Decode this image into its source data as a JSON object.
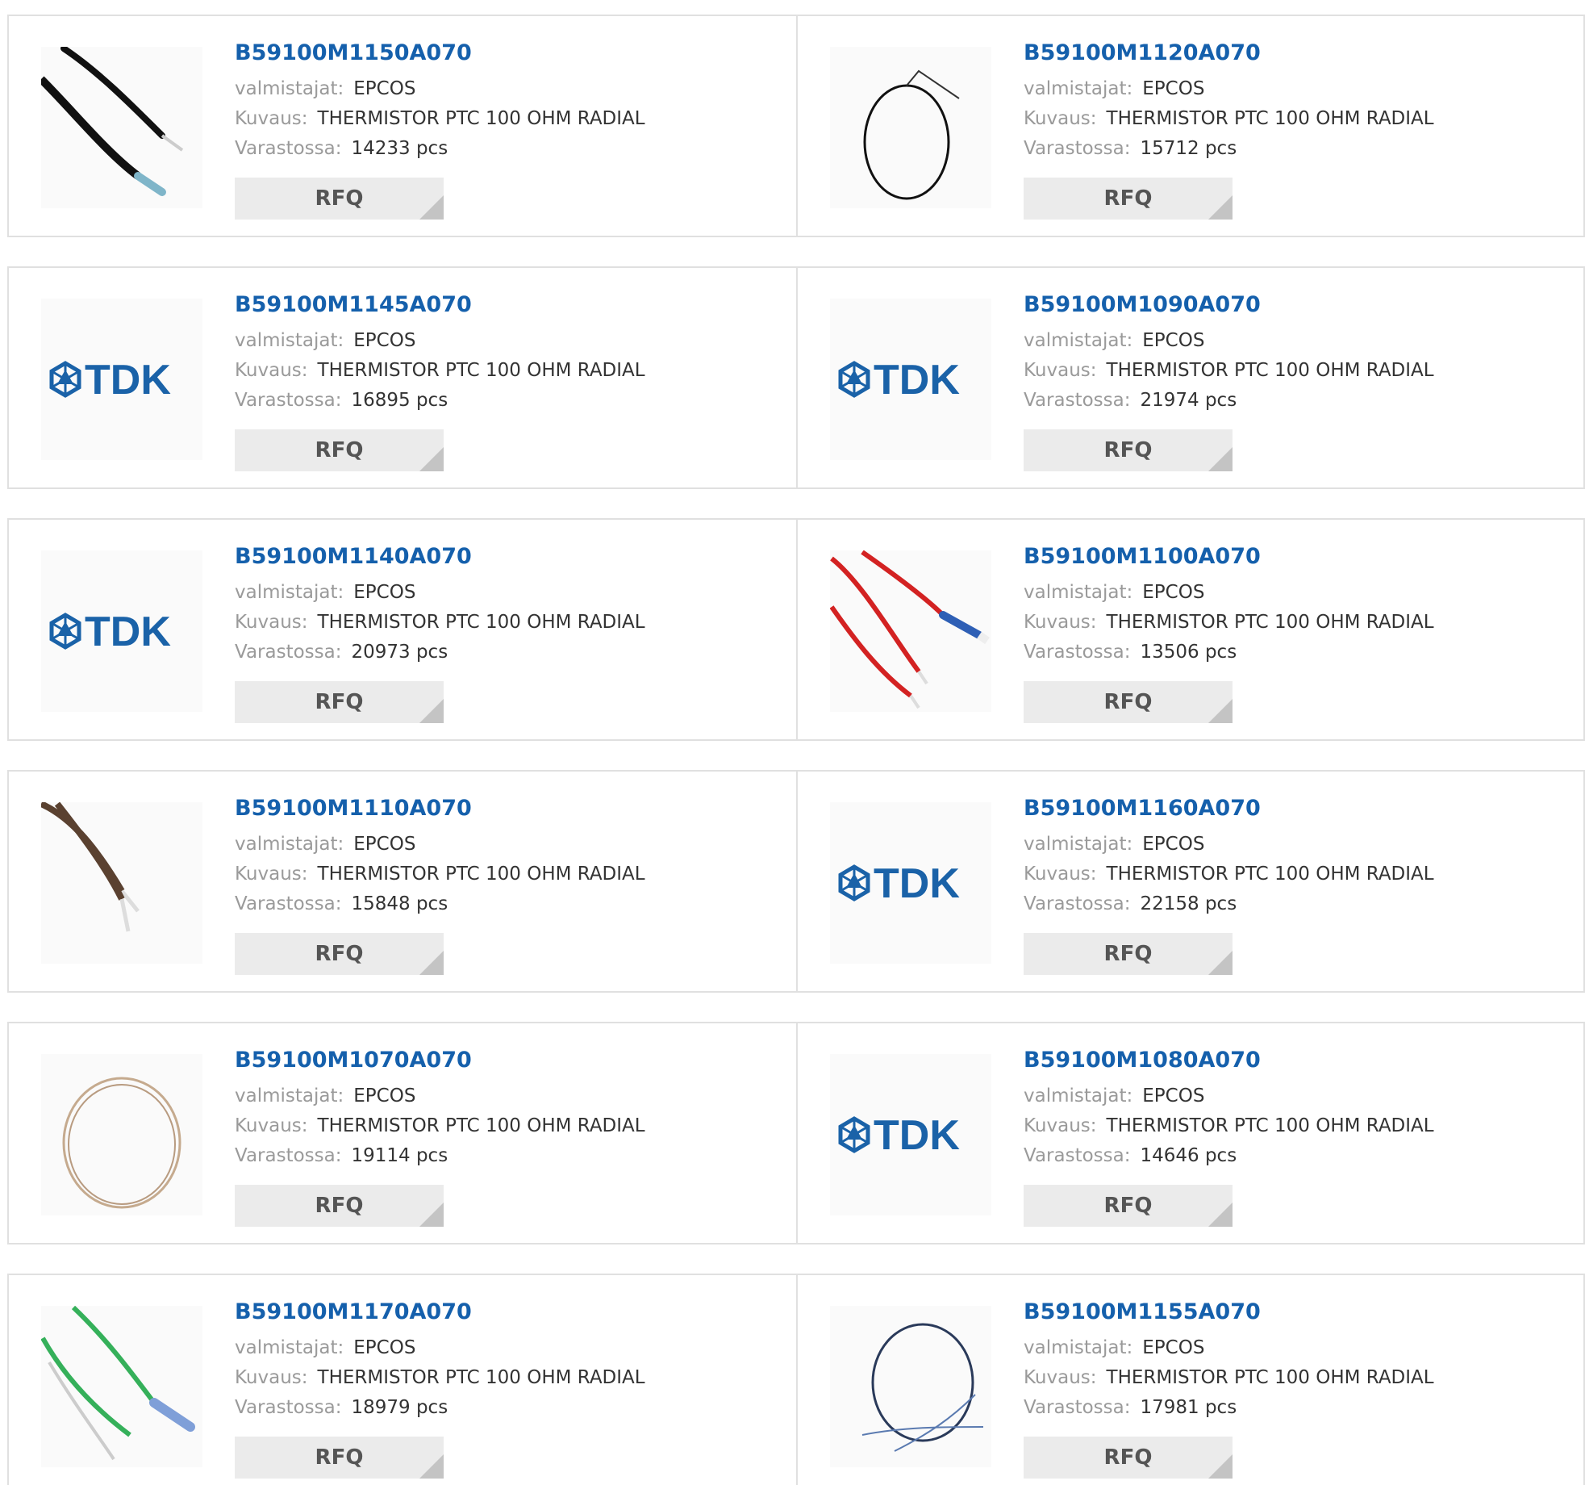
{
  "labels": {
    "manufacturer": "valmistajat:",
    "description": "Kuvaus:",
    "stock": "Varastossa:",
    "rfq": "RFQ"
  },
  "brand_logo_text": "TDK",
  "colors": {
    "part_link": "#1560ac",
    "label": "#9a9a9a",
    "value": "#333333",
    "rfq_bg": "#ebebeb",
    "border": "#e0e0e0"
  },
  "products": [
    {
      "part": "B59100M1150A070",
      "manufacturer": "EPCOS",
      "description": "THERMISTOR PTC 100 OHM RADIAL",
      "stock": "14233 pcs",
      "image": "black-wire-leads-photo"
    },
    {
      "part": "B59100M1120A070",
      "manufacturer": "EPCOS",
      "description": "THERMISTOR PTC 100 OHM RADIAL",
      "stock": "15712 pcs",
      "image": "black-wire-loop-photo"
    },
    {
      "part": "B59100M1145A070",
      "manufacturer": "EPCOS",
      "description": "THERMISTOR PTC 100 OHM RADIAL",
      "stock": "16895 pcs",
      "image": "tdk-logo"
    },
    {
      "part": "B59100M1090A070",
      "manufacturer": "EPCOS",
      "description": "THERMISTOR PTC 100 OHM RADIAL",
      "stock": "21974 pcs",
      "image": "tdk-logo"
    },
    {
      "part": "B59100M1140A070",
      "manufacturer": "EPCOS",
      "description": "THERMISTOR PTC 100 OHM RADIAL",
      "stock": "20973 pcs",
      "image": "tdk-logo"
    },
    {
      "part": "B59100M1100A070",
      "manufacturer": "EPCOS",
      "description": "THERMISTOR PTC 100 OHM RADIAL",
      "stock": "13506 pcs",
      "image": "red-wire-leads-photo"
    },
    {
      "part": "B59100M1110A070",
      "manufacturer": "EPCOS",
      "description": "THERMISTOR PTC 100 OHM RADIAL",
      "stock": "15848 pcs",
      "image": "brown-wire-leads-photo"
    },
    {
      "part": "B59100M1160A070",
      "manufacturer": "EPCOS",
      "description": "THERMISTOR PTC 100 OHM RADIAL",
      "stock": "22158 pcs",
      "image": "tdk-logo"
    },
    {
      "part": "B59100M1070A070",
      "manufacturer": "EPCOS",
      "description": "THERMISTOR PTC 100 OHM RADIAL",
      "stock": "19114 pcs",
      "image": "tan-wire-loop-photo"
    },
    {
      "part": "B59100M1080A070",
      "manufacturer": "EPCOS",
      "description": "THERMISTOR PTC 100 OHM RADIAL",
      "stock": "14646 pcs",
      "image": "tdk-logo"
    },
    {
      "part": "B59100M1170A070",
      "manufacturer": "EPCOS",
      "description": "THERMISTOR PTC 100 OHM RADIAL",
      "stock": "18979 pcs",
      "image": "green-wire-leads-photo"
    },
    {
      "part": "B59100M1155A070",
      "manufacturer": "EPCOS",
      "description": "THERMISTOR PTC 100 OHM RADIAL",
      "stock": "17981 pcs",
      "image": "blue-wire-loop-photo"
    }
  ]
}
